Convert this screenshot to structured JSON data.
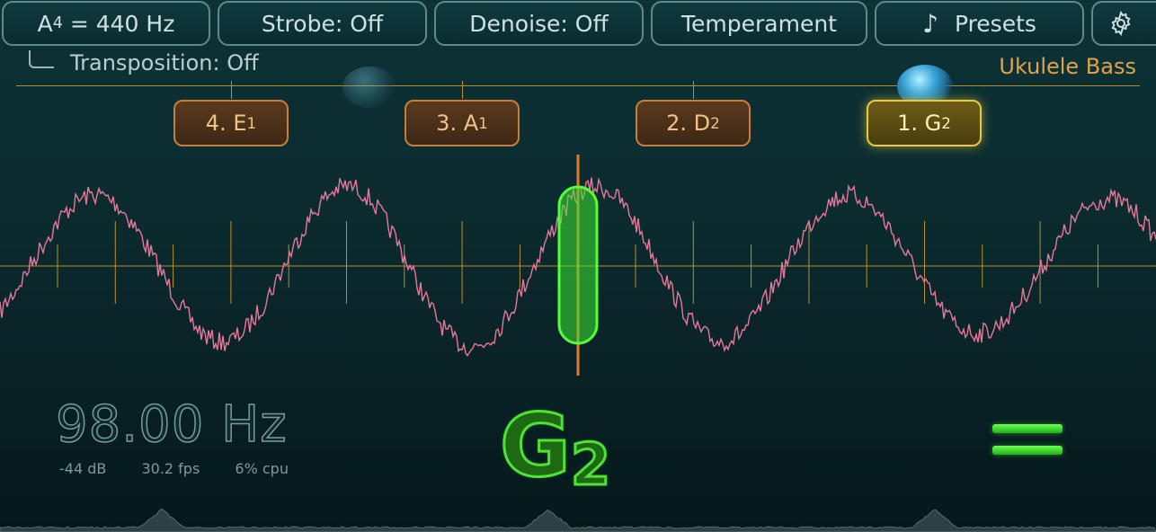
{
  "toolbar": {
    "a4_label": "A",
    "a4_sub": "4",
    "a4_value": " = 440 Hz",
    "strobe_label": "Strobe: Off",
    "denoise_label": "Denoise: Off",
    "temperament_label": "Temperament",
    "presets_label": "Presets",
    "presets_icon": "music-note-icon",
    "settings_icon": "gear-icon"
  },
  "transposition": "Transposition: Off",
  "instrument": "Ukulele Bass",
  "strings": [
    {
      "label": "4. E",
      "sub": "1",
      "active": false
    },
    {
      "label": "3. A",
      "sub": "1",
      "active": false
    },
    {
      "label": "2. D",
      "sub": "2",
      "active": false
    },
    {
      "label": "1. G",
      "sub": "2",
      "active": true
    }
  ],
  "readout": {
    "frequency": "98.00 Hz",
    "level": "-44 dB",
    "fps": "30.2 fps",
    "cpu": "6% cpu"
  },
  "note": {
    "letter": "G",
    "octave": "2"
  },
  "tuning_status_icon": "in-tune-equals-icon",
  "colors": {
    "waveform": "#e8779a",
    "needle": "#39e53a",
    "axis": "#b7902a",
    "pill_border": "#c97d3a",
    "pill_active": "#e8c93f",
    "instrument_text": "#e0a24a"
  }
}
